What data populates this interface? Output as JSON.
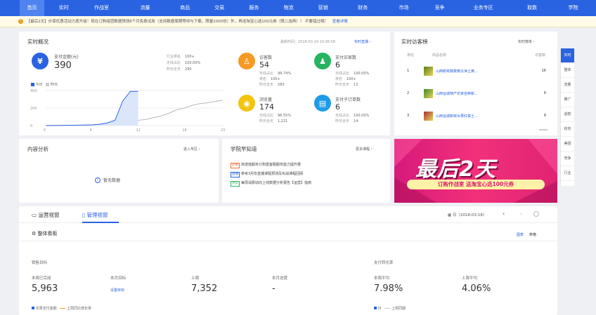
{
  "nav": [
    "首页",
    "实时",
    "作战室",
    "流量",
    "商品",
    "交易",
    "服务",
    "物流",
    "营销",
    "财务",
    "市场",
    "竞争",
    "业务专区",
    "取数",
    "学院"
  ],
  "notice": {
    "badge": "!",
    "text": "【最后2天】价保优惠活动力度升级！现在订购组团数据预测6个月免费试用（支持数据周期等待与下载，限量1000份）外，再送淘宝心选100元券（限二选再）！ 不要错过哦！",
    "link": "查看详情"
  },
  "realtime": {
    "title": "实时概况",
    "update_label": "最新时间：2018-03-19 10:06:58",
    "link": "实时直播",
    "pay": {
      "label": "支付金额(元)",
      "value": "390",
      "icon": "¥"
    },
    "pay_stats": [
      {
        "k": "行业排名",
        "v": "100+"
      },
      {
        "k": "无线占比",
        "v": "100.00%"
      },
      {
        "k": "昨日全天",
        "v": "290"
      }
    ],
    "legend_today": "今日",
    "legend_yesterday": "昨日",
    "chart_y_ticks": [
      "400",
      "200",
      "0"
    ],
    "chart_x_ticks": [
      "0",
      "6",
      "12",
      "18",
      "23"
    ],
    "metrics": [
      {
        "name": "访客数",
        "value": "54",
        "icon": "♙",
        "color": "#f59a23",
        "lines": [
          {
            "k": "无线占比",
            "v": "96.74%"
          },
          {
            "k": "排名",
            "v": "100+"
          },
          {
            "k": "昨日全天",
            "v": "283"
          }
        ]
      },
      {
        "name": "支付买家数",
        "value": "6",
        "icon": "♟",
        "color": "#27b460",
        "lines": [
          {
            "k": "无线占比",
            "v": "100.00%"
          },
          {
            "k": "排名",
            "v": "100+"
          },
          {
            "k": "昨日全天",
            "v": "13"
          }
        ]
      },
      {
        "name": "浏览量",
        "value": "174",
        "icon": "◉",
        "color": "#f2c40f",
        "lines": [
          {
            "k": "无线占比",
            "v": "96.55%"
          },
          {
            "k": "昨日全天",
            "v": "1,221"
          }
        ]
      },
      {
        "name": "支付子订单数",
        "value": "6",
        "icon": "▤",
        "color": "#1e9be8",
        "lines": [
          {
            "k": "无线占比",
            "v": "100.00%"
          },
          {
            "k": "昨日全天",
            "v": "14"
          }
        ]
      }
    ]
  },
  "chart_data": {
    "type": "line",
    "x": [
      0,
      1,
      2,
      3,
      4,
      5,
      6,
      7,
      8,
      9,
      10,
      11,
      12,
      13,
      14,
      15,
      16,
      17,
      18,
      19,
      20,
      21,
      22,
      23
    ],
    "ylim": [
      0,
      400
    ],
    "series": [
      {
        "name": "今日",
        "color": "#2a63e2",
        "values": [
          0,
          1,
          2,
          3,
          4,
          6,
          8,
          15,
          30,
          60,
          280,
          390,
          390
        ]
      },
      {
        "name": "昨日",
        "color": "#b8b8b8",
        "values": [
          0,
          1,
          2,
          3,
          4,
          5,
          7,
          10,
          14,
          20,
          30,
          50,
          60,
          70,
          90,
          110,
          140,
          180,
          200,
          230,
          250,
          260,
          275,
          290
        ]
      }
    ]
  },
  "visitors": {
    "title": "实时访客榜",
    "link": "实时榜单",
    "headers": [
      "排名",
      "商品名称",
      "访客数"
    ],
    "rows": [
      {
        "rank": "1",
        "name": "山西新鲜蔬菜黄瓜净土黄...",
        "count": "16",
        "c": "#5c7f1d"
      },
      {
        "rank": "2",
        "name": "山西运城特产农家自种新...",
        "count": "6",
        "c": "#3d8a2c"
      },
      {
        "rank": "3",
        "name": "山西运城新鲜水果红富士...",
        "count": "6",
        "c": "#a83232"
      }
    ]
  },
  "content": {
    "title": "内容分析",
    "link": "进入专区",
    "empty": "暂无数据"
  },
  "school": {
    "title": "学院早知道",
    "link": "更多课程",
    "items": [
      {
        "tag": "必看",
        "color": "#f56a3c",
        "text": "高增值服务订购暨客服服务能力提升赛"
      },
      {
        "tag": "直播",
        "color": "#2a63e2",
        "text": "参考3月份直播课程预测及实战课程回顾"
      },
      {
        "tag": "热议",
        "color": "#27b460",
        "text": "每周消费动向上线数据分析报告【运营】指南"
      }
    ]
  },
  "banner": {
    "title": "最后2天",
    "subtitle": "订购作战室 送淘宝心选100元券"
  },
  "side": [
    "实时",
    "整体",
    "流量",
    "推广",
    "退款",
    "财务",
    "美团",
    "竞争",
    "行业"
  ],
  "bottom": {
    "tab_ops": "运营视窗",
    "tab_mgmt": "管理视窗",
    "date": "日（2018-03-18）",
    "section": "整体看板",
    "toggle_a": "图表",
    "toggle_b": "表格",
    "sales_title": "销售目标",
    "conversion_title": "支付转化率",
    "kpis": [
      {
        "k": "本周已完成",
        "v": "5,963"
      },
      {
        "k": "本月目标",
        "v": "",
        "link": "设置目标"
      },
      {
        "k": "上周",
        "v": "7,352"
      },
      {
        "k": "本月进度",
        "v": "-"
      }
    ],
    "conv": [
      {
        "k": "本周平均",
        "v": "7.98%"
      },
      {
        "k": "上周平均",
        "v": "4.06%"
      }
    ],
    "legend_l1": "本周支付金额",
    "legend_l2": "上周同比增长率",
    "legend_r1": "日",
    "legend_r2": "上周同期"
  }
}
